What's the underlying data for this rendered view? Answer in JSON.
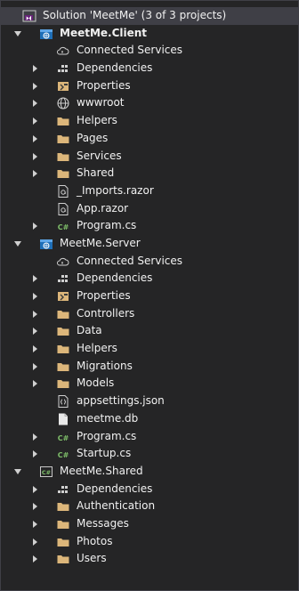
{
  "solution_explorer": {
    "solution_label": "Solution 'MeetMe' (3 of 3 projects)",
    "projects": [
      {
        "name": "MeetMe.Client",
        "items": [
          {
            "label": "Connected Services",
            "icon": "connected-services-icon"
          },
          {
            "label": "Dependencies",
            "icon": "dependencies-icon"
          },
          {
            "label": "Properties",
            "icon": "properties-icon"
          },
          {
            "label": "wwwroot",
            "icon": "globe-icon"
          },
          {
            "label": "Helpers",
            "icon": "folder-icon"
          },
          {
            "label": "Pages",
            "icon": "folder-icon"
          },
          {
            "label": "Services",
            "icon": "folder-icon"
          },
          {
            "label": "Shared",
            "icon": "folder-icon"
          },
          {
            "label": "_Imports.razor",
            "icon": "razor-file-icon"
          },
          {
            "label": "App.razor",
            "icon": "razor-file-icon"
          },
          {
            "label": "Program.cs",
            "icon": "csharp-file-icon"
          }
        ]
      },
      {
        "name": "MeetMe.Server",
        "items": [
          {
            "label": "Connected Services",
            "icon": "connected-services-icon"
          },
          {
            "label": "Dependencies",
            "icon": "dependencies-icon"
          },
          {
            "label": "Properties",
            "icon": "properties-icon"
          },
          {
            "label": "Controllers",
            "icon": "folder-icon"
          },
          {
            "label": "Data",
            "icon": "folder-icon"
          },
          {
            "label": "Helpers",
            "icon": "folder-icon"
          },
          {
            "label": "Migrations",
            "icon": "folder-icon"
          },
          {
            "label": "Models",
            "icon": "folder-icon"
          },
          {
            "label": "appsettings.json",
            "icon": "json-file-icon"
          },
          {
            "label": "meetme.db",
            "icon": "database-file-icon"
          },
          {
            "label": "Program.cs",
            "icon": "csharp-file-icon"
          },
          {
            "label": "Startup.cs",
            "icon": "csharp-file-icon"
          }
        ]
      },
      {
        "name": "MeetMe.Shared",
        "items": [
          {
            "label": "Dependencies",
            "icon": "dependencies-icon"
          },
          {
            "label": "Authentication",
            "icon": "folder-icon"
          },
          {
            "label": "Messages",
            "icon": "folder-icon"
          },
          {
            "label": "Photos",
            "icon": "folder-icon"
          },
          {
            "label": "Users",
            "icon": "folder-icon"
          }
        ]
      }
    ],
    "colors": {
      "background": "#252526",
      "text": "#f1f1f1",
      "folder": "#dcb67a",
      "csharp": "#7fbf6a",
      "vs_purple": "#68217a",
      "project_blue": "#1e6fb8"
    }
  }
}
